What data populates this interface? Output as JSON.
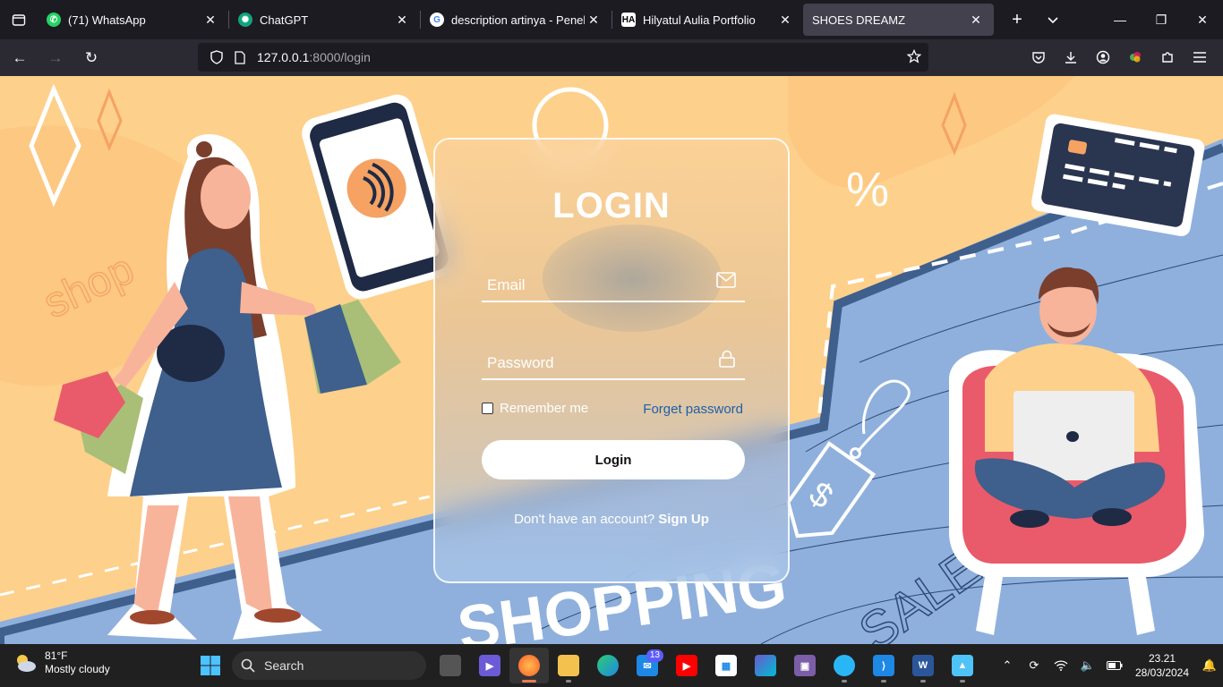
{
  "browser": {
    "tabs": [
      {
        "label": "(71) WhatsApp",
        "favicon": "whatsapp-icon",
        "color": "#25d366"
      },
      {
        "label": "ChatGPT",
        "favicon": "chatgpt-icon",
        "color": "#10a37f"
      },
      {
        "label": "description artinya - Penelusuran Google",
        "favicon": "google-icon",
        "color": "#ffffff"
      },
      {
        "label": "Hilyatul Aulia Portfolio",
        "favicon": "portfolio-icon",
        "color": "#ffffff"
      },
      {
        "label": "SHOES DREAMZ",
        "favicon": "page-icon",
        "color": "#42414d"
      }
    ],
    "url_host": "127.0.0.1",
    "url_path": ":8000/login"
  },
  "login": {
    "title": "LOGIN",
    "email_placeholder": "Email",
    "password_placeholder": "Password",
    "remember_label": "Remember me",
    "forgot_label": "Forget password",
    "button_label": "Login",
    "no_account_text": "Don't have an account?",
    "signup_label": "Sign Up"
  },
  "background": {
    "shop_text": "shop",
    "shopping_text": "SHOPPING",
    "sale_text": "SALE",
    "percent_text": "%"
  },
  "taskbar": {
    "weather_temp": "81°F",
    "weather_desc": "Mostly cloudy",
    "search_label": "Search",
    "mail_badge": "13",
    "time": "23.21",
    "date": "28/03/2024"
  }
}
